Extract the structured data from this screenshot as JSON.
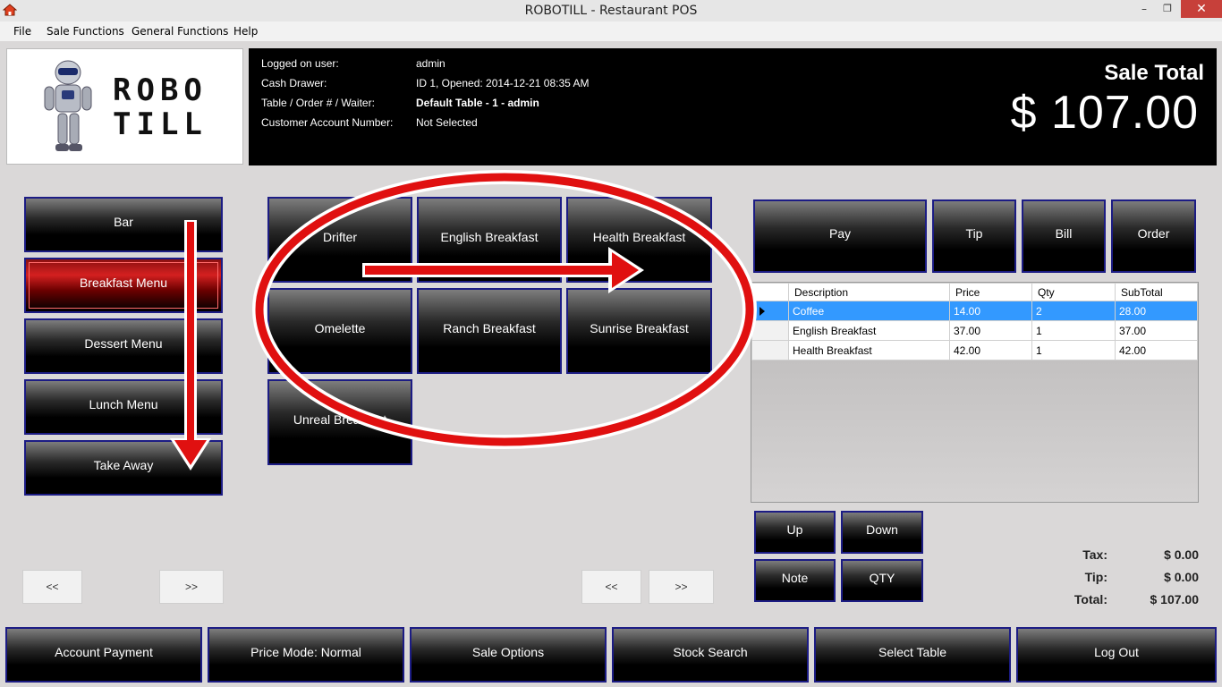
{
  "window": {
    "title": "ROBOTILL - Restaurant POS",
    "min": "–",
    "max": "❐",
    "close": "✕"
  },
  "menu": {
    "file": "File",
    "sale_functions": "Sale Functions",
    "general_functions": "General Functions",
    "help": "Help"
  },
  "logo": {
    "line1": "ROBO",
    "line2": "TILL"
  },
  "info": {
    "logged_on_user_label": "Logged on user:",
    "logged_on_user": "admin",
    "cash_drawer_label": "Cash Drawer:",
    "cash_drawer": "ID 1, Opened: 2014-12-21 08:35 AM",
    "table_label": "Table / Order # / Waiter:",
    "table": "Default Table - 1 - admin",
    "customer_label": "Customer Account Number:",
    "customer": "Not Selected",
    "sale_total_label": "Sale Total",
    "sale_total": "$ 107.00"
  },
  "categories": [
    "Bar",
    "Breakfast Menu",
    "Dessert Menu",
    "Lunch Menu",
    "Take Away"
  ],
  "products": [
    "Drifter",
    "English Breakfast",
    "Health Breakfast",
    "Omelette",
    "Ranch Breakfast",
    "Sunrise Breakfast",
    "Unreal Breakfast"
  ],
  "nav": {
    "prev": "<<",
    "next": ">>"
  },
  "actions": {
    "pay": "Pay",
    "tip": "Tip",
    "bill": "Bill",
    "order": "Order"
  },
  "grid": {
    "headers": [
      "Description",
      "Price",
      "Qty",
      "SubTotal"
    ],
    "rows": [
      [
        "Coffee",
        "14.00",
        "2",
        "28.00"
      ],
      [
        "English Breakfast",
        "37.00",
        "1",
        "37.00"
      ],
      [
        "Health Breakfast",
        "42.00",
        "1",
        "42.00"
      ]
    ]
  },
  "row_controls": {
    "up": "Up",
    "down": "Down",
    "note": "Note",
    "qty": "QTY"
  },
  "totals": {
    "tax_label": "Tax:",
    "tax": "$ 0.00",
    "tip_label": "Tip:",
    "tip": "$ 0.00",
    "total_label": "Total:",
    "total": "$ 107.00"
  },
  "footer": [
    "Account Payment",
    "Price Mode: Normal",
    "Sale Options",
    "Stock Search",
    "Select Table",
    "Log Out"
  ],
  "colors": {
    "accent_border": "#1c1c84",
    "selected_row": "#3399ff",
    "annotation": "#e01010"
  }
}
